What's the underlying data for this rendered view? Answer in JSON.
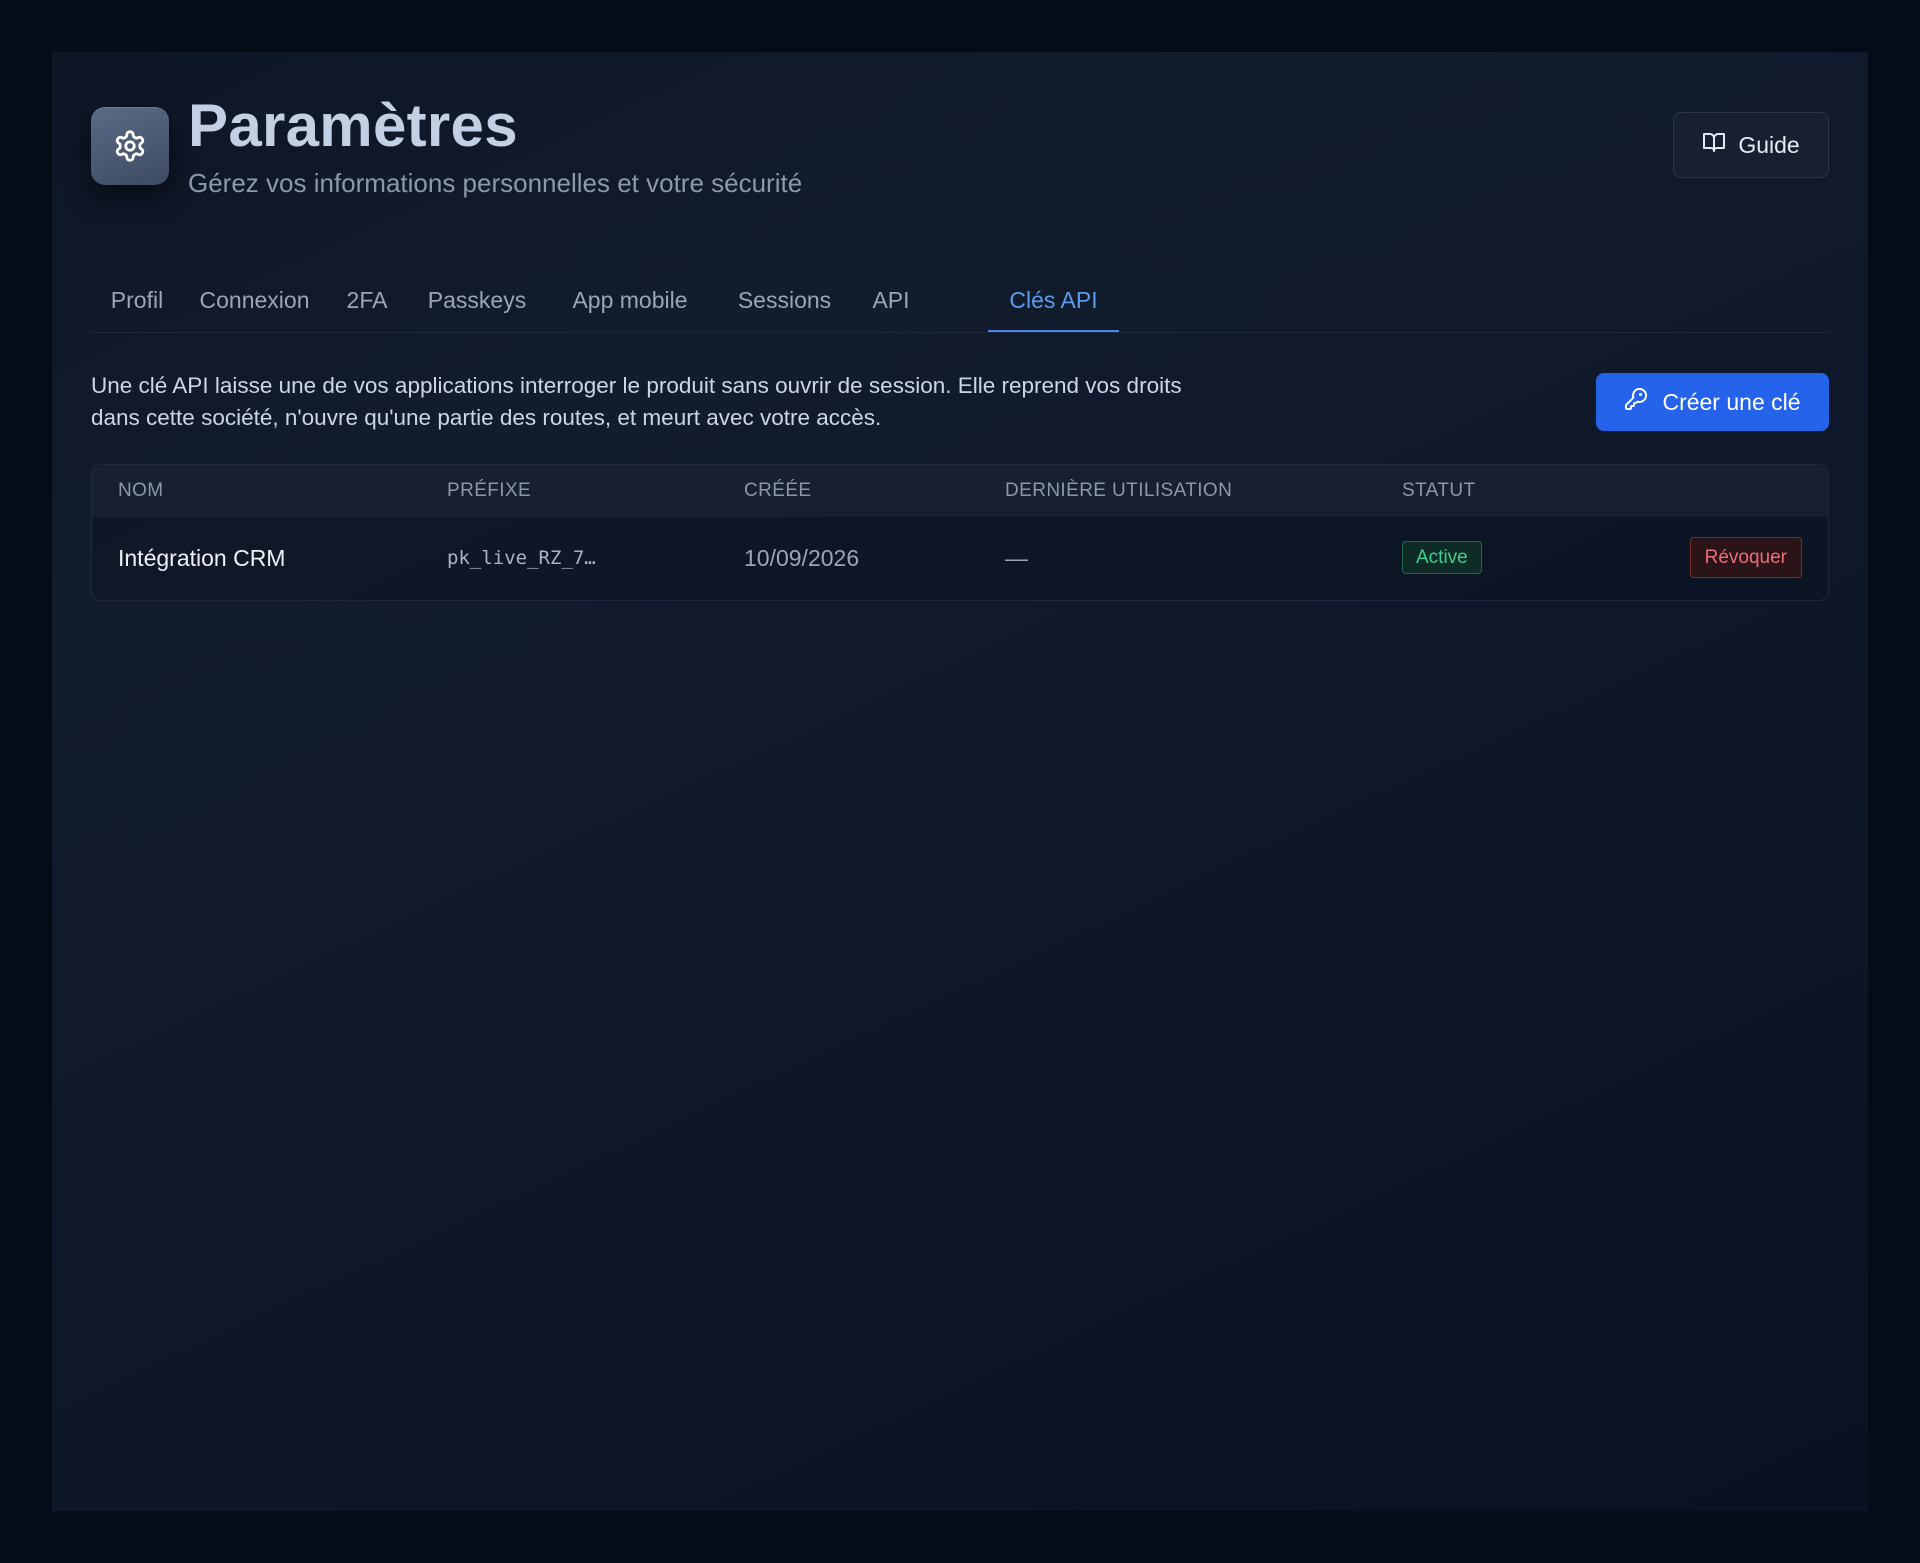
{
  "header": {
    "icon": "gear-icon",
    "title": "Paramètres",
    "subtitle": "Gérez vos informations personnelles et votre sécurité",
    "guide_icon": "book-icon",
    "guide_label": "Guide"
  },
  "tabs": [
    {
      "label": "Profil",
      "active": false
    },
    {
      "label": "Connexion",
      "active": false
    },
    {
      "label": "2FA",
      "active": false
    },
    {
      "label": "Passkeys",
      "active": false
    },
    {
      "label": "App mobile",
      "active": false
    },
    {
      "label": "Sessions",
      "active": false
    },
    {
      "label": "API",
      "active": false
    },
    {
      "label": "Clés API",
      "active": true
    }
  ],
  "api_keys": {
    "description": "Une clé API laisse une de vos applications interroger le produit sans ouvrir de session. Elle reprend vos droits dans cette société, n'ouvre qu'une partie des routes, et meurt avec votre accès.",
    "create_icon": "key-icon",
    "create_label": "Créer une clé",
    "table": {
      "columns": [
        "NOM",
        "PRÉFIXE",
        "CRÉÉE",
        "DERNIÈRE UTILISATION",
        "STATUT"
      ],
      "rows": [
        {
          "name": "Intégration CRM",
          "prefix": "pk_live_RZ_7…",
          "created": "10/09/2026",
          "last_used": "—",
          "status": "Active",
          "action": "Révoquer"
        }
      ]
    }
  },
  "colors": {
    "accent": "#2563eb",
    "active_tab": "#5b9cf0",
    "status_active": "#3fcf8e",
    "danger": "#ec6f78",
    "background": "#060b18"
  }
}
